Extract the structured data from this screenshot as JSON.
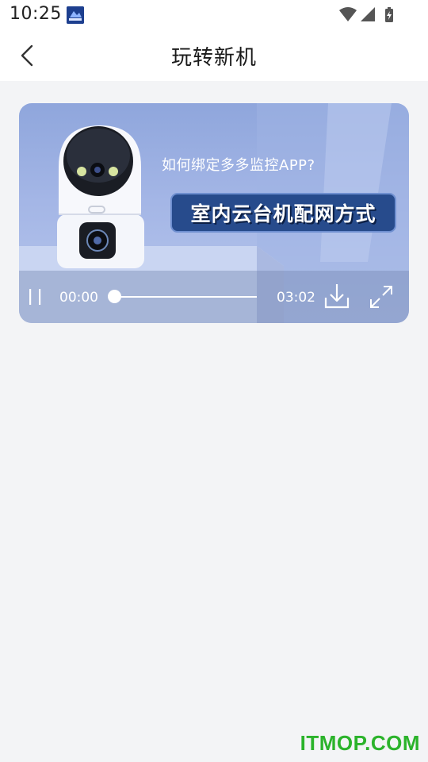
{
  "status_bar": {
    "time": "10:25",
    "app_icon": "wallet-app-icon",
    "icons": [
      "wifi-icon",
      "signal-icon",
      "battery-charging-icon"
    ]
  },
  "header": {
    "title": "玩转新机",
    "back_icon": "chevron-left-icon"
  },
  "video": {
    "question": "如何绑定多多监控APP?",
    "headline": "室内云台机配网方式",
    "current_time": "00:00",
    "total_time": "03:02",
    "progress": 0,
    "playing": true,
    "controls": {
      "play_pause_icon": "pause-icon",
      "download_icon": "download-icon",
      "fullscreen_icon": "fullscreen-icon"
    }
  },
  "watermark": "ITMOP.COM",
  "colors": {
    "page_background": "#f3f4f6",
    "header_background": "#ffffff",
    "headline_background": "#274b8c",
    "watermark": "#2bb32b"
  }
}
